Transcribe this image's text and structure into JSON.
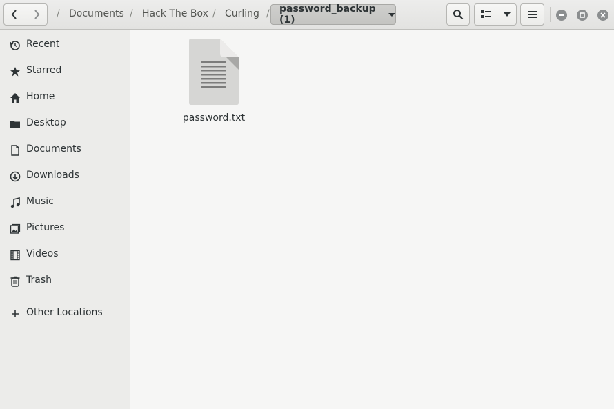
{
  "header": {
    "breadcrumbs": [
      "Documents",
      "Hack The Box",
      "Curling"
    ],
    "current_folder": "password_backup (1)",
    "icons": {
      "back": "chevron-left-icon",
      "forward": "chevron-right-icon",
      "search": "search-icon",
      "view": "list-view-icon",
      "view_options": "chevron-down-icon",
      "menu": "hamburger-menu-icon",
      "minimize": "minimize-icon",
      "maximize": "maximize-icon",
      "close": "close-icon"
    }
  },
  "sidebar": {
    "items": [
      {
        "label": "Recent",
        "icon": "clock-icon"
      },
      {
        "label": "Starred",
        "icon": "star-icon"
      },
      {
        "label": "Home",
        "icon": "home-icon"
      },
      {
        "label": "Desktop",
        "icon": "folder-icon"
      },
      {
        "label": "Documents",
        "icon": "document-icon"
      },
      {
        "label": "Downloads",
        "icon": "download-icon"
      },
      {
        "label": "Music",
        "icon": "music-icon"
      },
      {
        "label": "Pictures",
        "icon": "pictures-icon"
      },
      {
        "label": "Videos",
        "icon": "film-icon"
      },
      {
        "label": "Trash",
        "icon": "trash-icon"
      }
    ],
    "other_locations": {
      "label": "Other Locations",
      "icon": "plus-icon"
    }
  },
  "files": [
    {
      "name": "password.txt",
      "icon": "text-file-icon"
    }
  ],
  "colors": {
    "headerbar": "#e8e8e7",
    "sidebar": "#ececea",
    "content": "#f6f6f5",
    "active_crumb": "#c9c9c7",
    "window_button": "#8b8e8f"
  }
}
